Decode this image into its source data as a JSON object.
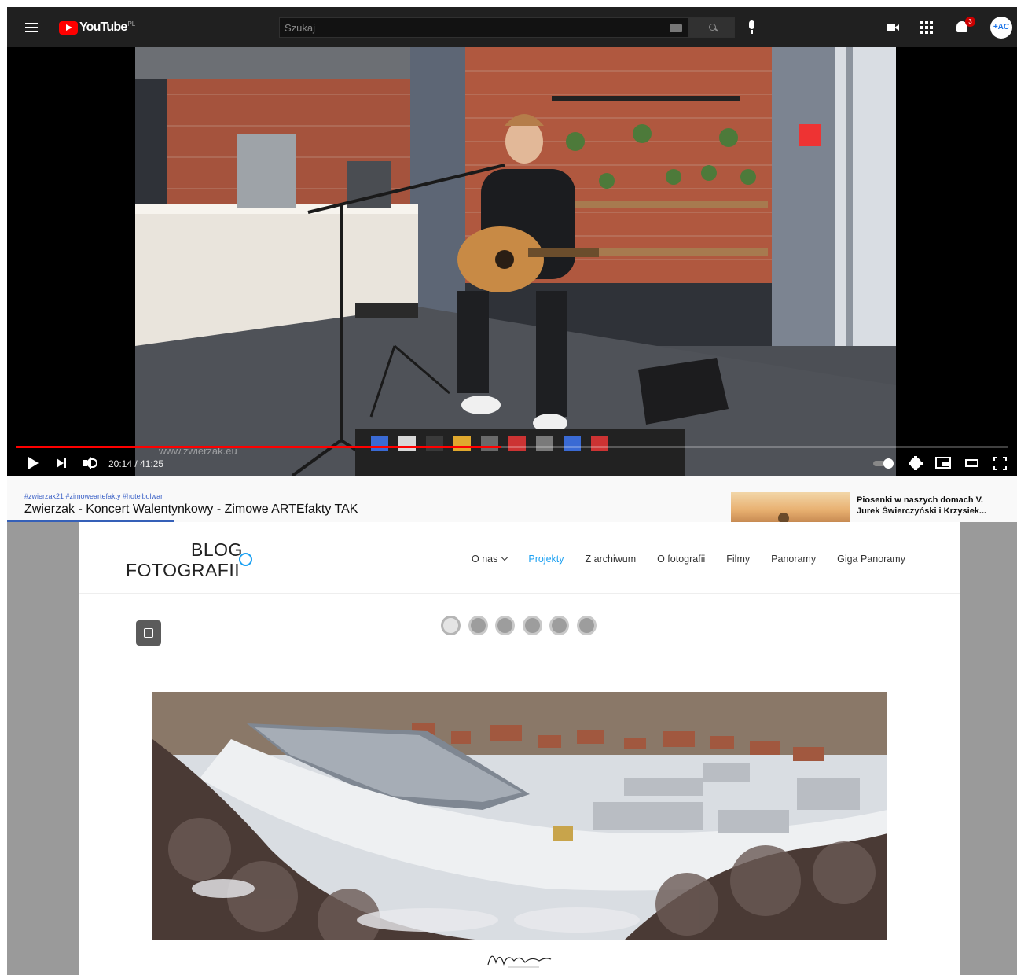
{
  "youtube": {
    "logo_text": "YouTube",
    "region": "PL",
    "search": {
      "placeholder": "Szukaj"
    },
    "notifications_count": "3",
    "avatar_text": "+AC",
    "player": {
      "time_current": "20:14",
      "time_total": "41:25",
      "time_display": "20:14 / 41:25",
      "progress_fraction": 0.4886,
      "watermark": "www.zwierzak.eu"
    },
    "info": {
      "hashtags": "#zwierzak21 #zimoweartefakty #hotelbulwar",
      "title": "Zwierzak - Koncert Walentynkowy - Zimowe ARTEfakty TAK"
    },
    "suggested": {
      "title": "Piosenki w naszych domach V. Jurek Świerczyński i Krzysiek..."
    }
  },
  "blog": {
    "logo_line1": "BLOG",
    "logo_line2": "FOTOGRAFII",
    "nav": [
      {
        "label": "O nas",
        "has_dropdown": true,
        "active": false
      },
      {
        "label": "Projekty",
        "has_dropdown": false,
        "active": true
      },
      {
        "label": "Z archiwum",
        "has_dropdown": false,
        "active": false
      },
      {
        "label": "O fotografii",
        "has_dropdown": false,
        "active": false
      },
      {
        "label": "Filmy",
        "has_dropdown": false,
        "active": false
      },
      {
        "label": "Panoramy",
        "has_dropdown": false,
        "active": false
      },
      {
        "label": "Giga Panoramy",
        "has_dropdown": false,
        "active": false
      }
    ],
    "slider": {
      "count": 6,
      "active_index": 0
    },
    "accent_color": "#1da1f2"
  },
  "colors": {
    "youtube_header": "#202020",
    "youtube_red": "#ff0000",
    "blog_bg": "#9a9a9a"
  }
}
